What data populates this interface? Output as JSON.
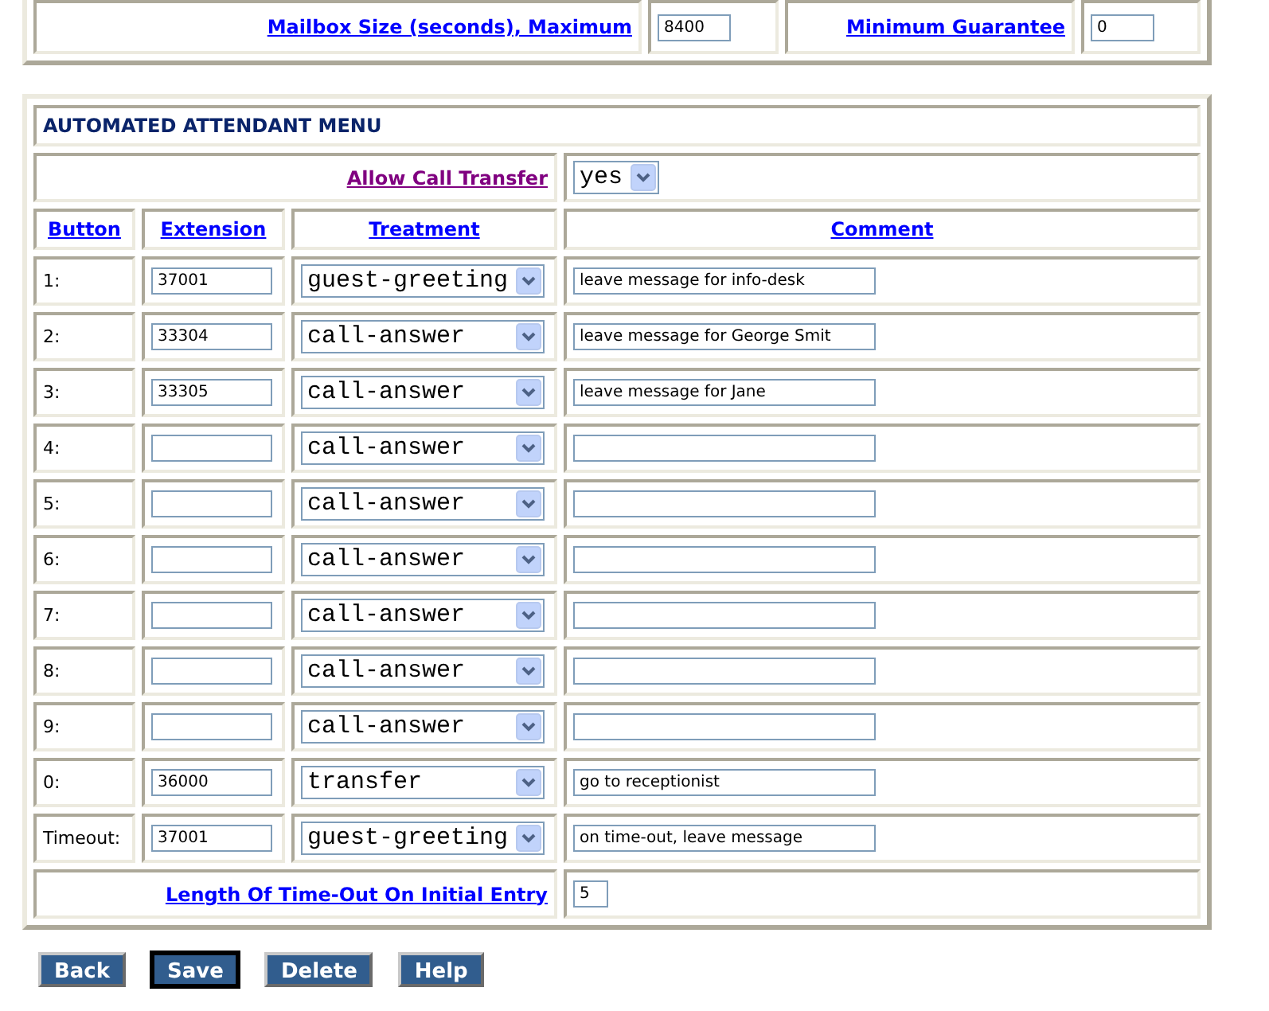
{
  "mailbox_panel": {
    "fields": [
      {
        "label": "Mailbox Size (seconds), Maximum",
        "value": "8400"
      },
      {
        "label": "Minimum Guarantee",
        "value": "0"
      }
    ]
  },
  "attendant_menu": {
    "title": "AUTOMATED ATTENDANT MENU",
    "allow_call_transfer": {
      "label": "Allow Call Transfer",
      "visited": true,
      "value": "yes"
    },
    "columns": [
      "Button",
      "Extension",
      "Treatment",
      "Comment"
    ],
    "rows": [
      {
        "button": "1:",
        "extension": "37001",
        "treatment": "guest-greeting",
        "comment": "leave message for info-desk"
      },
      {
        "button": "2:",
        "extension": "33304",
        "treatment": "call-answer",
        "comment": "leave message for George Smit"
      },
      {
        "button": "3:",
        "extension": "33305",
        "treatment": "call-answer",
        "comment": "leave message for Jane"
      },
      {
        "button": "4:",
        "treatment": "call-answer"
      },
      {
        "button": "5:",
        "treatment": "call-answer"
      },
      {
        "button": "6:",
        "treatment": "call-answer"
      },
      {
        "button": "7:",
        "treatment": "call-answer"
      },
      {
        "button": "8:",
        "treatment": "call-answer"
      },
      {
        "button": "9:",
        "treatment": "call-answer"
      },
      {
        "button": "0:",
        "extension": "36000",
        "treatment": "transfer",
        "comment": "go to receptionist"
      },
      {
        "button": "Timeout:",
        "extension": "37001",
        "treatment": "guest-greeting",
        "comment": "on time-out, leave message"
      }
    ],
    "timeout_length": {
      "label": "Length Of Time-Out On Initial Entry",
      "value": "5"
    }
  },
  "buttons": [
    {
      "label": "Back",
      "focused": false
    },
    {
      "label": "Save",
      "focused": true
    },
    {
      "label": "Delete",
      "focused": false
    },
    {
      "label": "Help",
      "focused": false
    }
  ]
}
